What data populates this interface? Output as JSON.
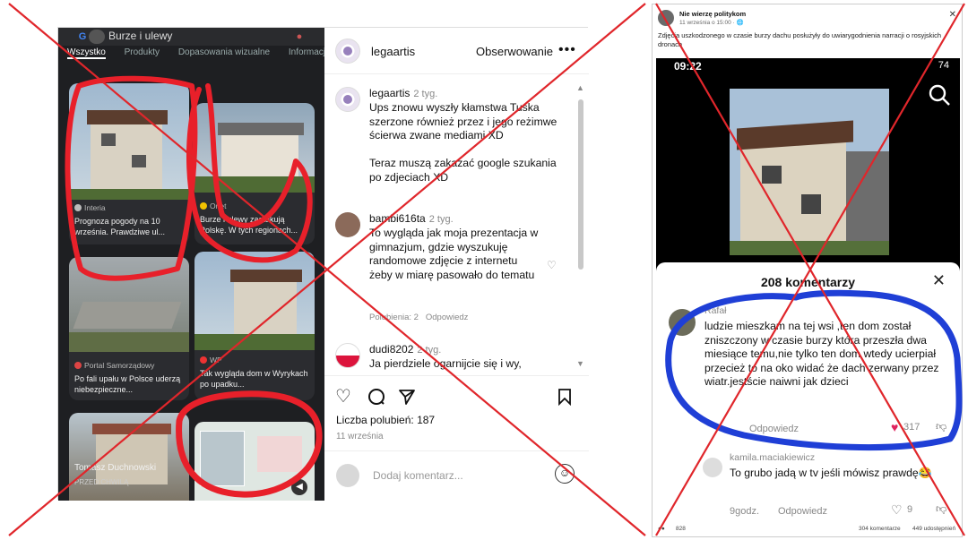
{
  "left": {
    "gallery": {
      "query": "Burze i ulewy",
      "tabs": [
        "Wszystko",
        "Produkty",
        "Dopasowania wizualne",
        "Informacje"
      ],
      "cards": [
        {
          "source": "Interia",
          "caption": "Prognoza pogody na 10 września. Prawdziwe ul..."
        },
        {
          "source": "Onet",
          "caption": "Burze i ulewy zaatakują Polskę. W tych regionach..."
        },
        {
          "source": "Portal Samorządowy",
          "caption": "Po fali upału w Polsce uderzą niebezpieczne..."
        },
        {
          "source": "WP",
          "caption": "Tak wygląda dom w Wyrykach po upadku..."
        }
      ],
      "watermark_name": "Tomasz Duchnowski",
      "watermark_sub": "PRZED CHWILĄ"
    },
    "instagram": {
      "username": "legaartis",
      "follow_label": "Obserwowanie",
      "more_label": "•••",
      "comments": [
        {
          "user": "legaartis",
          "time": "2 tyg.",
          "text": "Ups znowu wyszły kłamstwa Tuska szerzone również przez  i jego reżimwe ścierwa zwane mediami XD\n\nTeraz muszą zakazać google szukania po zdjeciach XD"
        },
        {
          "user": "bambi616ta",
          "time": "2 tyg.",
          "text": "To wygląda jak moja prezentacja w gimnazjum, gdzie wyszukuję randomowe zdjęcie z internetu żeby w miarę pasowało do tematu",
          "likes_label": "Polubienia: 2",
          "reply_label": "Odpowiedz"
        },
        {
          "user": "dudi8202",
          "time": "2 tyg.",
          "text": "Ja pierdziele ogarnijcie się i wy,"
        }
      ],
      "likes": "Liczba polubień: 187",
      "date": "11 września",
      "add_comment_placeholder": "Dodaj komentarz..."
    }
  },
  "right": {
    "page_name": "Nie wierzę politykom",
    "post_time": "11 września o 15:00 · 🌐",
    "post_text": "Zdjęcia uszkodzonego w czasie burzy dachu posłużyły do uwiarygodnienia narracji o rosyjskich dronach",
    "phone": {
      "clock": "09:22",
      "battery": "74",
      "comments_title": "208 komentarzy",
      "comments": [
        {
          "user": "Rafał",
          "text": "ludzie mieszkam na tej wsi ,ten dom został zniszczony w czasie burzy która przeszła dwa miesiące temu,nie tylko ten dom wtedy ucierpiał przecież to na oko widać że dach zerwany przez wiatr.jestście naiwni jak dzieci",
          "reply_label": "Odpowiedz",
          "likes": "317"
        },
        {
          "user": "kamila.maciakiewicz",
          "text": "To grubo jadą w tv jeśli mówisz prawdę😂",
          "time": "9godz.",
          "reply_label": "Odpowiedz",
          "likes": "9"
        }
      ]
    },
    "footer": {
      "reactions": "828",
      "comments": "304 komentarze",
      "shares": "449 udostępnień"
    }
  },
  "colors": {
    "cross": "#e0262b",
    "scribble_red": "#e8202a",
    "scribble_blue": "#1f3fd6"
  }
}
